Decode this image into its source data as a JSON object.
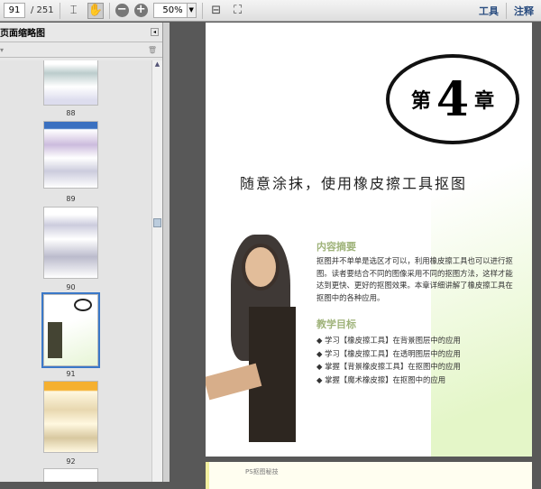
{
  "toolbar": {
    "page_current": "91",
    "page_total": "/ 251",
    "zoom": "50%",
    "tools_label": "工具",
    "comment_label": "注释"
  },
  "sidebar": {
    "title": "页面缩略图",
    "thumbnails": [
      {
        "label": "88"
      },
      {
        "label": "89"
      },
      {
        "label": "90"
      },
      {
        "label": "91",
        "selected": true
      },
      {
        "label": "92"
      }
    ]
  },
  "page": {
    "chapter_prefix": "第",
    "chapter_num": "4",
    "chapter_suffix": "章",
    "title": "随意涂抹，使用橡皮擦工具抠图",
    "summary_heading": "内容摘要",
    "summary": "抠图并不单单是选区才可以，利用橡皮擦工具也可以进行抠图。读者要结合不同的图像采用不同的抠图方法，这样才能达到更快、更好的抠图效果。本章详细讲解了橡皮擦工具在抠图中的各种应用。",
    "goals_heading": "教学目标",
    "goals": [
      "学习【橡皮擦工具】在背景图层中的应用",
      "学习【橡皮擦工具】在透明图层中的应用",
      "掌握【背景橡皮擦工具】在抠图中的应用",
      "掌握【魔术橡皮擦】在抠图中的应用"
    ]
  },
  "next_page": {
    "header": "PS抠图秘技"
  }
}
